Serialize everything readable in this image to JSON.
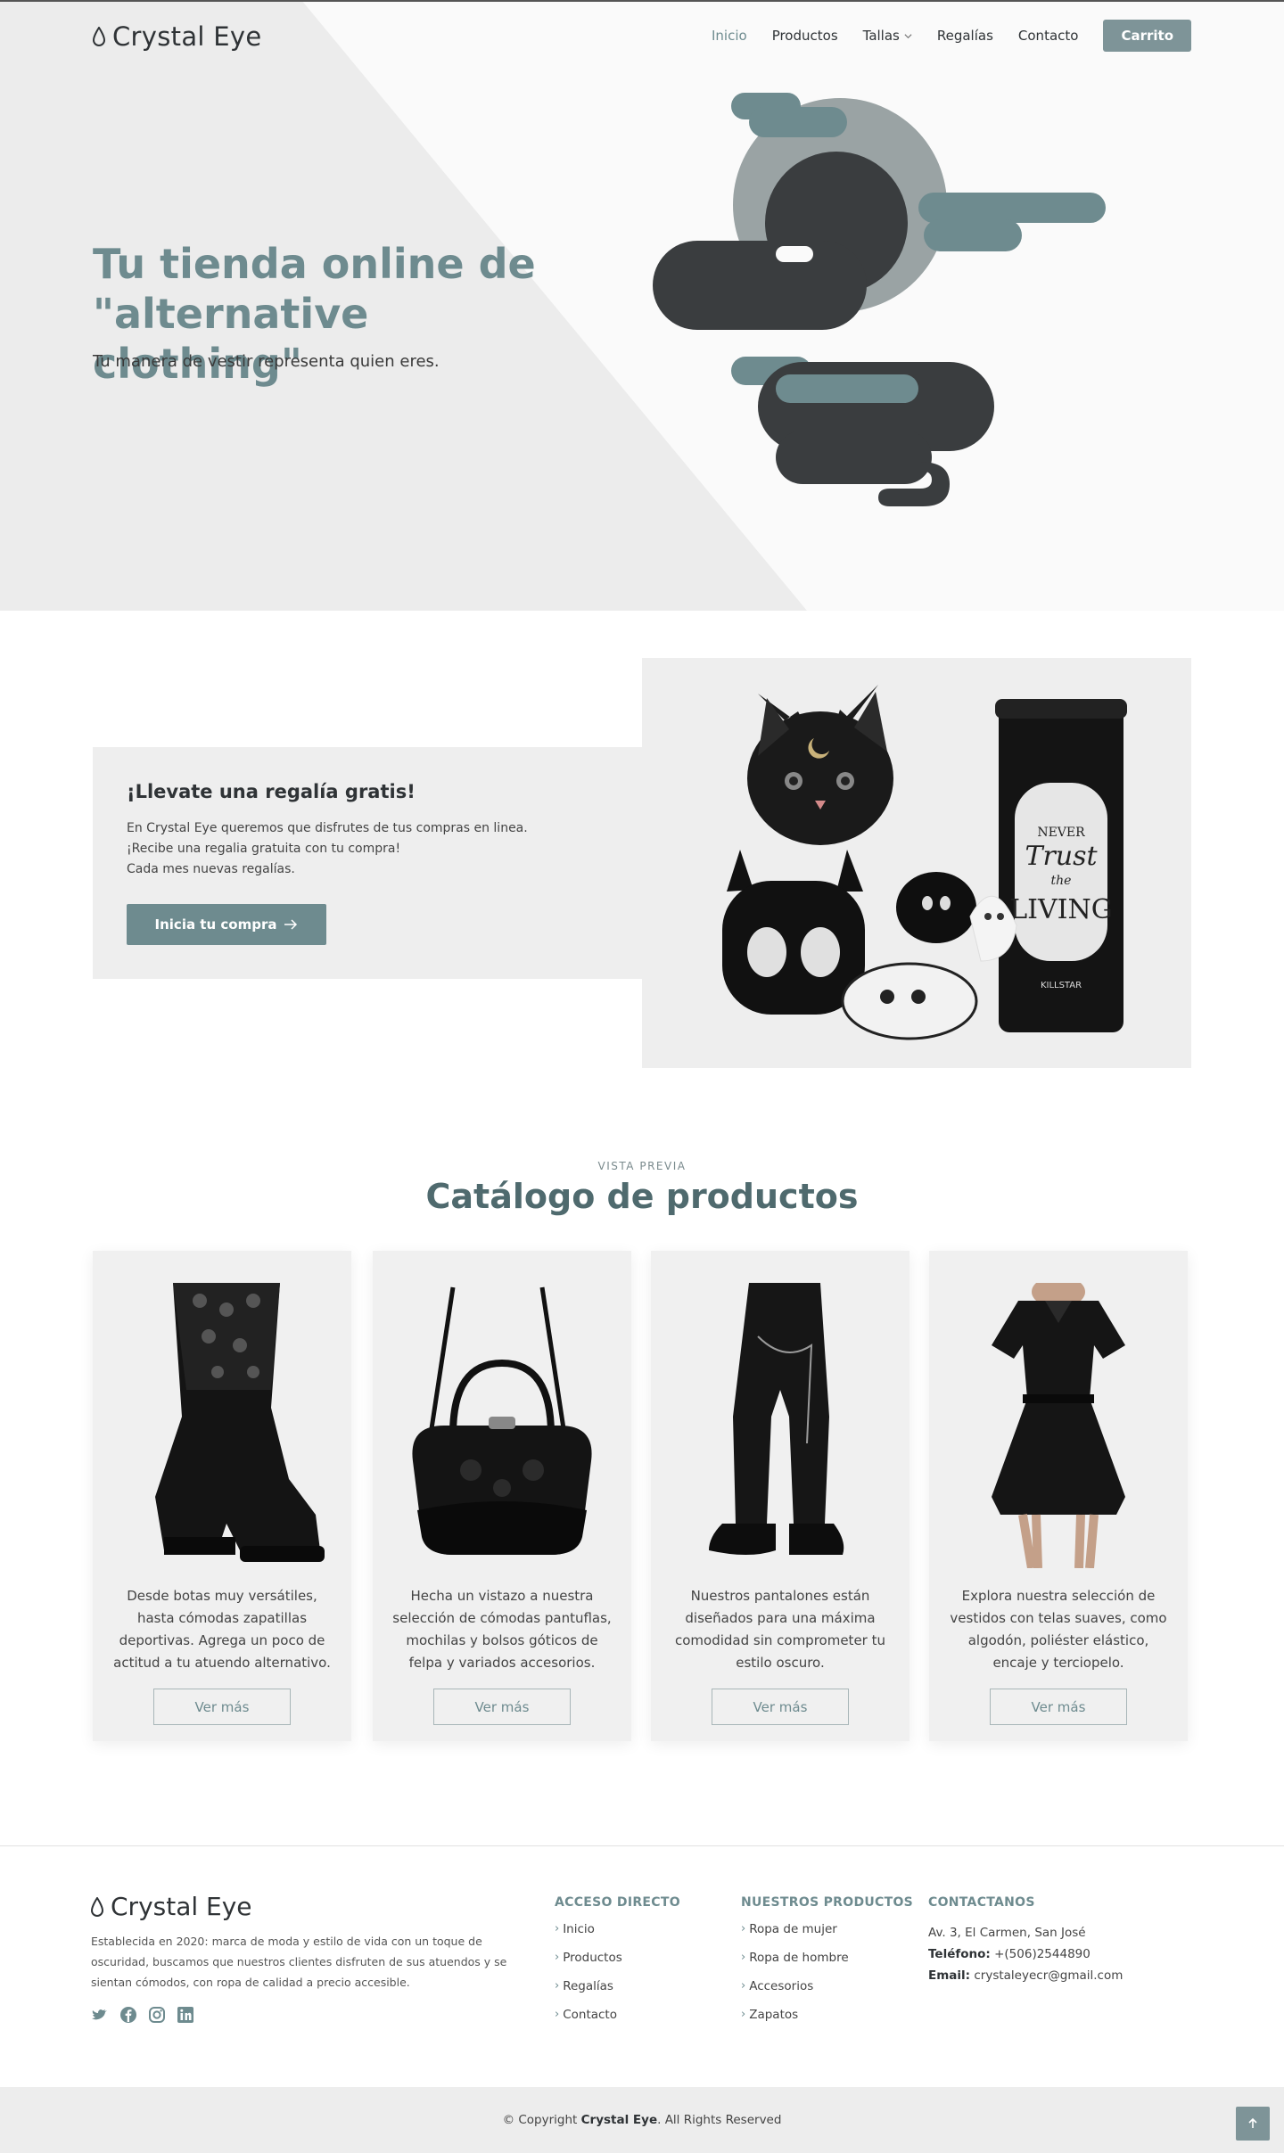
{
  "brand": {
    "name": "Crystal Eye"
  },
  "nav": {
    "items": [
      "Inicio",
      "Productos",
      "Tallas",
      "Regalías",
      "Contacto"
    ],
    "active": "Inicio",
    "cart": "Carrito"
  },
  "hero": {
    "title": "Tu tienda online de \"alternative clothing\"",
    "subtitle": "Tu manera de vestir representa quien eres."
  },
  "promo": {
    "title": "¡Llevate una regalía gratis!",
    "lines": [
      "En Crystal Eye queremos que disfrutes de tus compras en linea.",
      "¡Recibe una regalia gratuita con tu compra!",
      "Cada mes nuevas regalías."
    ],
    "button": "Inicia tu compra",
    "image_text": {
      "line1": "NEVER",
      "line2": "Trust",
      "line3": "the",
      "line4": "LIVING",
      "brand": "KILLSTAR"
    }
  },
  "catalog": {
    "kicker": "VISTA PREVIA",
    "title": "Catálogo de productos",
    "cards": [
      {
        "icon": "boots-image",
        "text": "Desde botas muy versátiles, hasta cómodas zapatillas deportivas. Agrega un poco de actitud a tu atuendo alternativo.",
        "button": "Ver más"
      },
      {
        "icon": "handbag-image",
        "text": "Hecha un vistazo a nuestra selección de cómodas pantuflas, mochilas y bolsos góticos de felpa y variados accesorios.",
        "button": "Ver más"
      },
      {
        "icon": "pants-image",
        "text": "Nuestros pantalones están diseñados para una máxima comodidad sin comprometer tu estilo oscuro.",
        "button": "Ver más"
      },
      {
        "icon": "dress-image",
        "text": "Explora nuestra selección de vestidos con telas suaves, como algodón, poliéster elástico, encaje y terciopelo.",
        "button": "Ver más"
      }
    ]
  },
  "footer": {
    "about": "Establecida en 2020: marca de moda y estilo de vida con un toque de oscuridad, buscamos que nuestros clientes disfruten de sus atuendos y se sientan cómodos, con ropa de calidad a precio accesible.",
    "socials": [
      "twitter-icon",
      "facebook-icon",
      "instagram-icon",
      "linkedin-icon"
    ],
    "quick": {
      "heading": "ACCESO DIRECTO",
      "items": [
        "Inicio",
        "Productos",
        "Regalías",
        "Contacto"
      ]
    },
    "products": {
      "heading": "NUESTROS PRODUCTOS",
      "items": [
        "Ropa de mujer",
        "Ropa de hombre",
        "Accesorios",
        "Zapatos"
      ]
    },
    "contact": {
      "heading": "CONTACTANOS",
      "address": "Av. 3, El Carmen, San José",
      "phone_label": "Teléfono:",
      "phone": "+(506)2544890",
      "email_label": "Email:",
      "email": "crystaleyecr@gmail.com"
    },
    "copyright_prefix": "© Copyright",
    "copyright_brand": "Crystal Eye",
    "copyright_suffix": ". All Rights Reserved"
  },
  "colors": {
    "accent": "#6e8b8f",
    "accent_light": "#7e9498",
    "dark": "#3a3d3f",
    "grey": "#9aa3a4"
  }
}
